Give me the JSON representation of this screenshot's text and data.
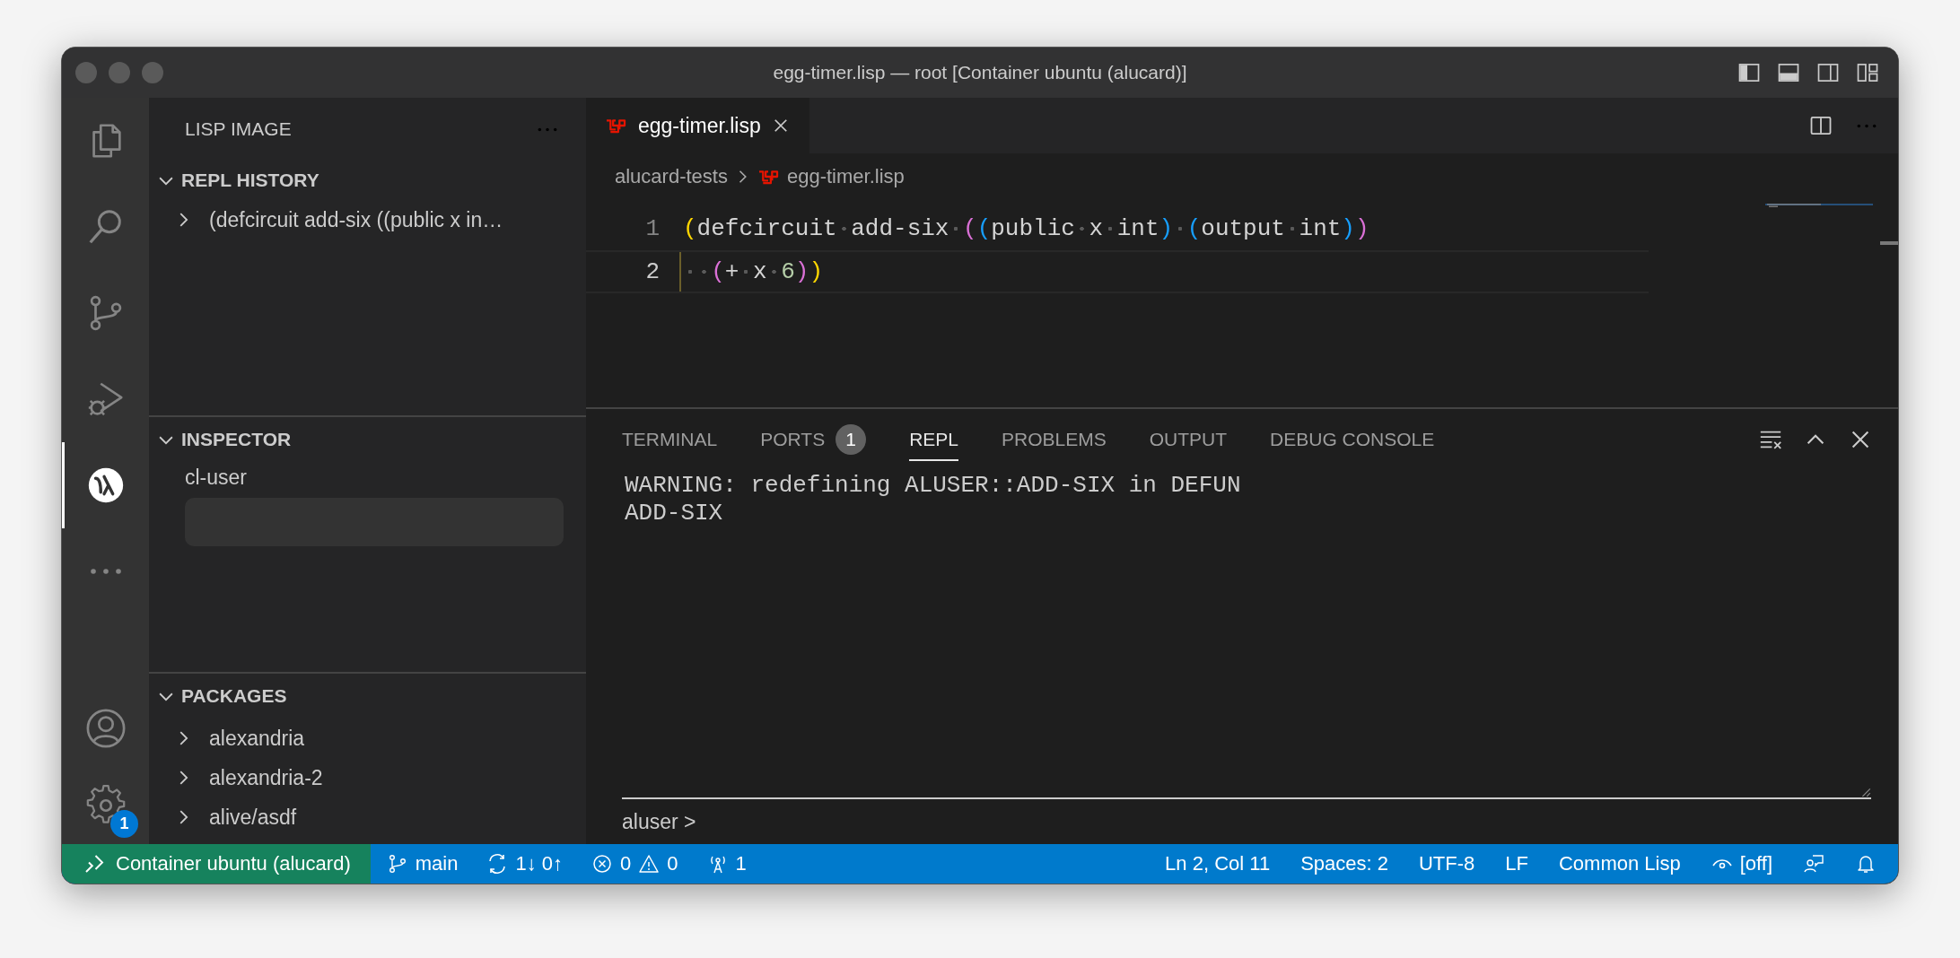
{
  "window": {
    "title": "egg-timer.lisp — root [Container ubuntu (alucard)]",
    "layout_toggles": [
      {
        "kind": "sidebar",
        "on": true
      },
      {
        "kind": "panel",
        "on": true
      },
      {
        "kind": "secondary",
        "on": false
      },
      {
        "kind": "customize"
      }
    ]
  },
  "activity_bar": {
    "items": [
      {
        "kind": "files",
        "selected": false
      },
      {
        "kind": "search",
        "selected": false
      },
      {
        "kind": "scm",
        "selected": false
      },
      {
        "kind": "debug",
        "selected": false
      },
      {
        "kind": "alive",
        "selected": true
      },
      {
        "kind": "more",
        "selected": false
      }
    ],
    "bottom": [
      {
        "kind": "account"
      },
      {
        "kind": "settings",
        "badge": "1"
      }
    ]
  },
  "sidebar": {
    "title": "LISP IMAGE",
    "sections": [
      {
        "kind": "tree",
        "title": "REPL HISTORY",
        "expanded": true,
        "items": [
          {
            "label": "(defcircuit add-six ((public x in…",
            "expanded": false
          }
        ]
      },
      {
        "kind": "inspector",
        "title": "INSPECTOR",
        "expanded": true,
        "package": "cl-user"
      },
      {
        "kind": "tree",
        "title": "PACKAGES",
        "expanded": true,
        "items": [
          {
            "label": "alexandria",
            "expanded": false
          },
          {
            "label": "alexandria-2",
            "expanded": false
          },
          {
            "label": "alive/asdf",
            "expanded": false
          }
        ]
      }
    ]
  },
  "editor": {
    "tabs": [
      {
        "label": "egg-timer.lisp",
        "selected": true
      }
    ],
    "breadcrumb": [
      {
        "kind": "folder",
        "label": "alucard-tests"
      },
      {
        "kind": "file",
        "label": "egg-timer.lisp"
      }
    ],
    "lines": [
      {
        "number": "1",
        "current": false,
        "tokens": [
          {
            "kind": "b1",
            "text": "("
          },
          {
            "kind": "plain",
            "text": "defcircuit"
          },
          {
            "kind": "space"
          },
          {
            "kind": "plain",
            "text": "add-six"
          },
          {
            "kind": "space"
          },
          {
            "kind": "b2",
            "text": "("
          },
          {
            "kind": "b3",
            "text": "("
          },
          {
            "kind": "plain",
            "text": "public"
          },
          {
            "kind": "space"
          },
          {
            "kind": "plain",
            "text": "x"
          },
          {
            "kind": "space"
          },
          {
            "kind": "plain",
            "text": "int"
          },
          {
            "kind": "b3",
            "text": ")"
          },
          {
            "kind": "space"
          },
          {
            "kind": "b3",
            "text": "("
          },
          {
            "kind": "plain",
            "text": "output"
          },
          {
            "kind": "space"
          },
          {
            "kind": "plain",
            "text": "int"
          },
          {
            "kind": "b3",
            "text": ")"
          },
          {
            "kind": "b2",
            "text": ")"
          }
        ]
      },
      {
        "number": "2",
        "current": true,
        "tokens": [
          {
            "kind": "space"
          },
          {
            "kind": "space"
          },
          {
            "kind": "b2",
            "text": "("
          },
          {
            "kind": "plain",
            "text": "+"
          },
          {
            "kind": "space"
          },
          {
            "kind": "plain",
            "text": "x"
          },
          {
            "kind": "space"
          },
          {
            "kind": "number",
            "text": "6"
          },
          {
            "kind": "b2",
            "text": ")"
          },
          {
            "kind": "b1",
            "text": ")"
          }
        ]
      }
    ]
  },
  "panel": {
    "tabs": [
      {
        "label": "TERMINAL",
        "selected": false
      },
      {
        "label": "PORTS",
        "selected": false,
        "badge": "1"
      },
      {
        "label": "REPL",
        "selected": true
      },
      {
        "label": "PROBLEMS",
        "selected": false
      },
      {
        "label": "OUTPUT",
        "selected": false
      },
      {
        "label": "DEBUG CONSOLE",
        "selected": false
      }
    ],
    "output": [
      "WARNING: redefining ALUSER::ADD-SIX in DEFUN",
      "ADD-SIX"
    ],
    "prompt": "aluser >"
  },
  "status_bar": {
    "remote": "Container ubuntu (alucard)",
    "left": [
      {
        "kind": "branch",
        "text": "main"
      },
      {
        "kind": "sync",
        "text": "1↓ 0↑"
      },
      {
        "kind": "errors",
        "text": "0"
      },
      {
        "kind": "warnings",
        "text": "0"
      },
      {
        "kind": "ports",
        "text": "1"
      }
    ],
    "right": [
      {
        "kind": "text",
        "text": "Ln 2, Col 11"
      },
      {
        "kind": "text",
        "text": "Spaces: 2"
      },
      {
        "kind": "text",
        "text": "UTF-8"
      },
      {
        "kind": "text",
        "text": "LF"
      },
      {
        "kind": "text",
        "text": "Common Lisp"
      },
      {
        "kind": "eye",
        "text": "[off]"
      },
      {
        "kind": "feedback"
      },
      {
        "kind": "bell"
      }
    ]
  }
}
